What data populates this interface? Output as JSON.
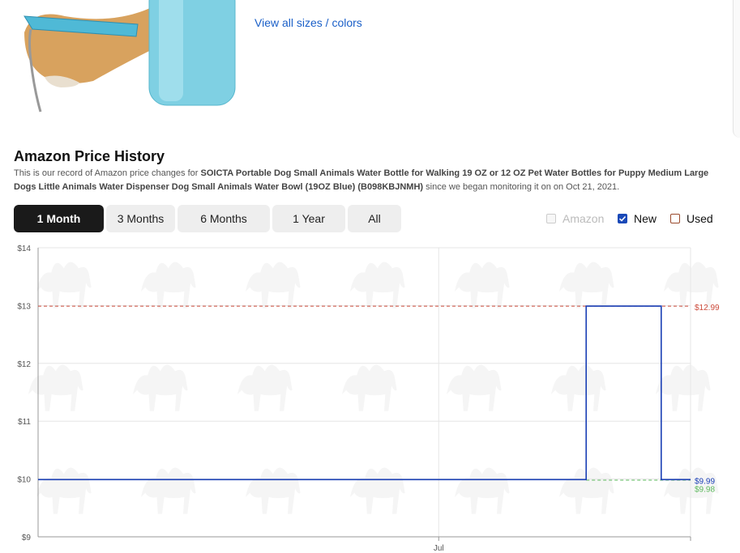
{
  "product": {
    "view_all_link": "View all sizes / colors"
  },
  "section": {
    "title": "Amazon Price History",
    "desc_prefix": "This is our record of Amazon price changes for ",
    "product_name": "SOICTA Portable Dog Small Animals Water Bottle for Walking 19 OZ or 12 OZ Pet Water Bottles for Puppy Medium Large Dogs Little Animals Water Dispenser Dog Small Animals Water Bowl (19OZ Blue) (B098KBJNMH)",
    "desc_suffix": " since we began monitoring it on on Oct 21, 2021."
  },
  "range_tabs": [
    {
      "label": "1 Month",
      "active": true
    },
    {
      "label": "3 Months",
      "active": false
    },
    {
      "label": "6 Months",
      "active": false
    },
    {
      "label": "1 Year",
      "active": false
    },
    {
      "label": "All",
      "active": false
    }
  ],
  "series_toggles": [
    {
      "label": "Amazon",
      "checked": false,
      "enabled": false
    },
    {
      "label": "New",
      "checked": true,
      "enabled": true
    },
    {
      "label": "Used",
      "checked": false,
      "enabled": true
    }
  ],
  "colors": {
    "new_series": "#1a3fb5",
    "high_line": "#cc4a3a",
    "low_line": "#5bb85b",
    "grid": "#e6e6e6",
    "tab_active_bg": "#1a1a1a",
    "link": "#1a5fc8"
  },
  "chart_data": {
    "type": "line",
    "step": true,
    "grid": true,
    "ylim": [
      9,
      14
    ],
    "y_ticks": [
      "$14",
      "$13",
      "$12",
      "$11",
      "$10",
      "$9"
    ],
    "x_tick_labels": [
      "Jul"
    ],
    "series": [
      {
        "name": "New",
        "step_values": [
          9.99,
          9.99,
          12.99,
          12.99,
          9.99,
          9.99
        ],
        "step_fractions": [
          0,
          0.84,
          0.84,
          0.955,
          0.955,
          1.0
        ]
      }
    ],
    "annotations": [
      {
        "label": "$12.99",
        "value": 12.99,
        "style": "dashed",
        "color": "#cc4a3a"
      },
      {
        "label": "$9.99",
        "value": 9.99,
        "style": "solid",
        "color": "#1a3fb5"
      },
      {
        "label": "$9.98",
        "value": 9.98,
        "style": "dashed",
        "color": "#5bb85b"
      }
    ]
  }
}
